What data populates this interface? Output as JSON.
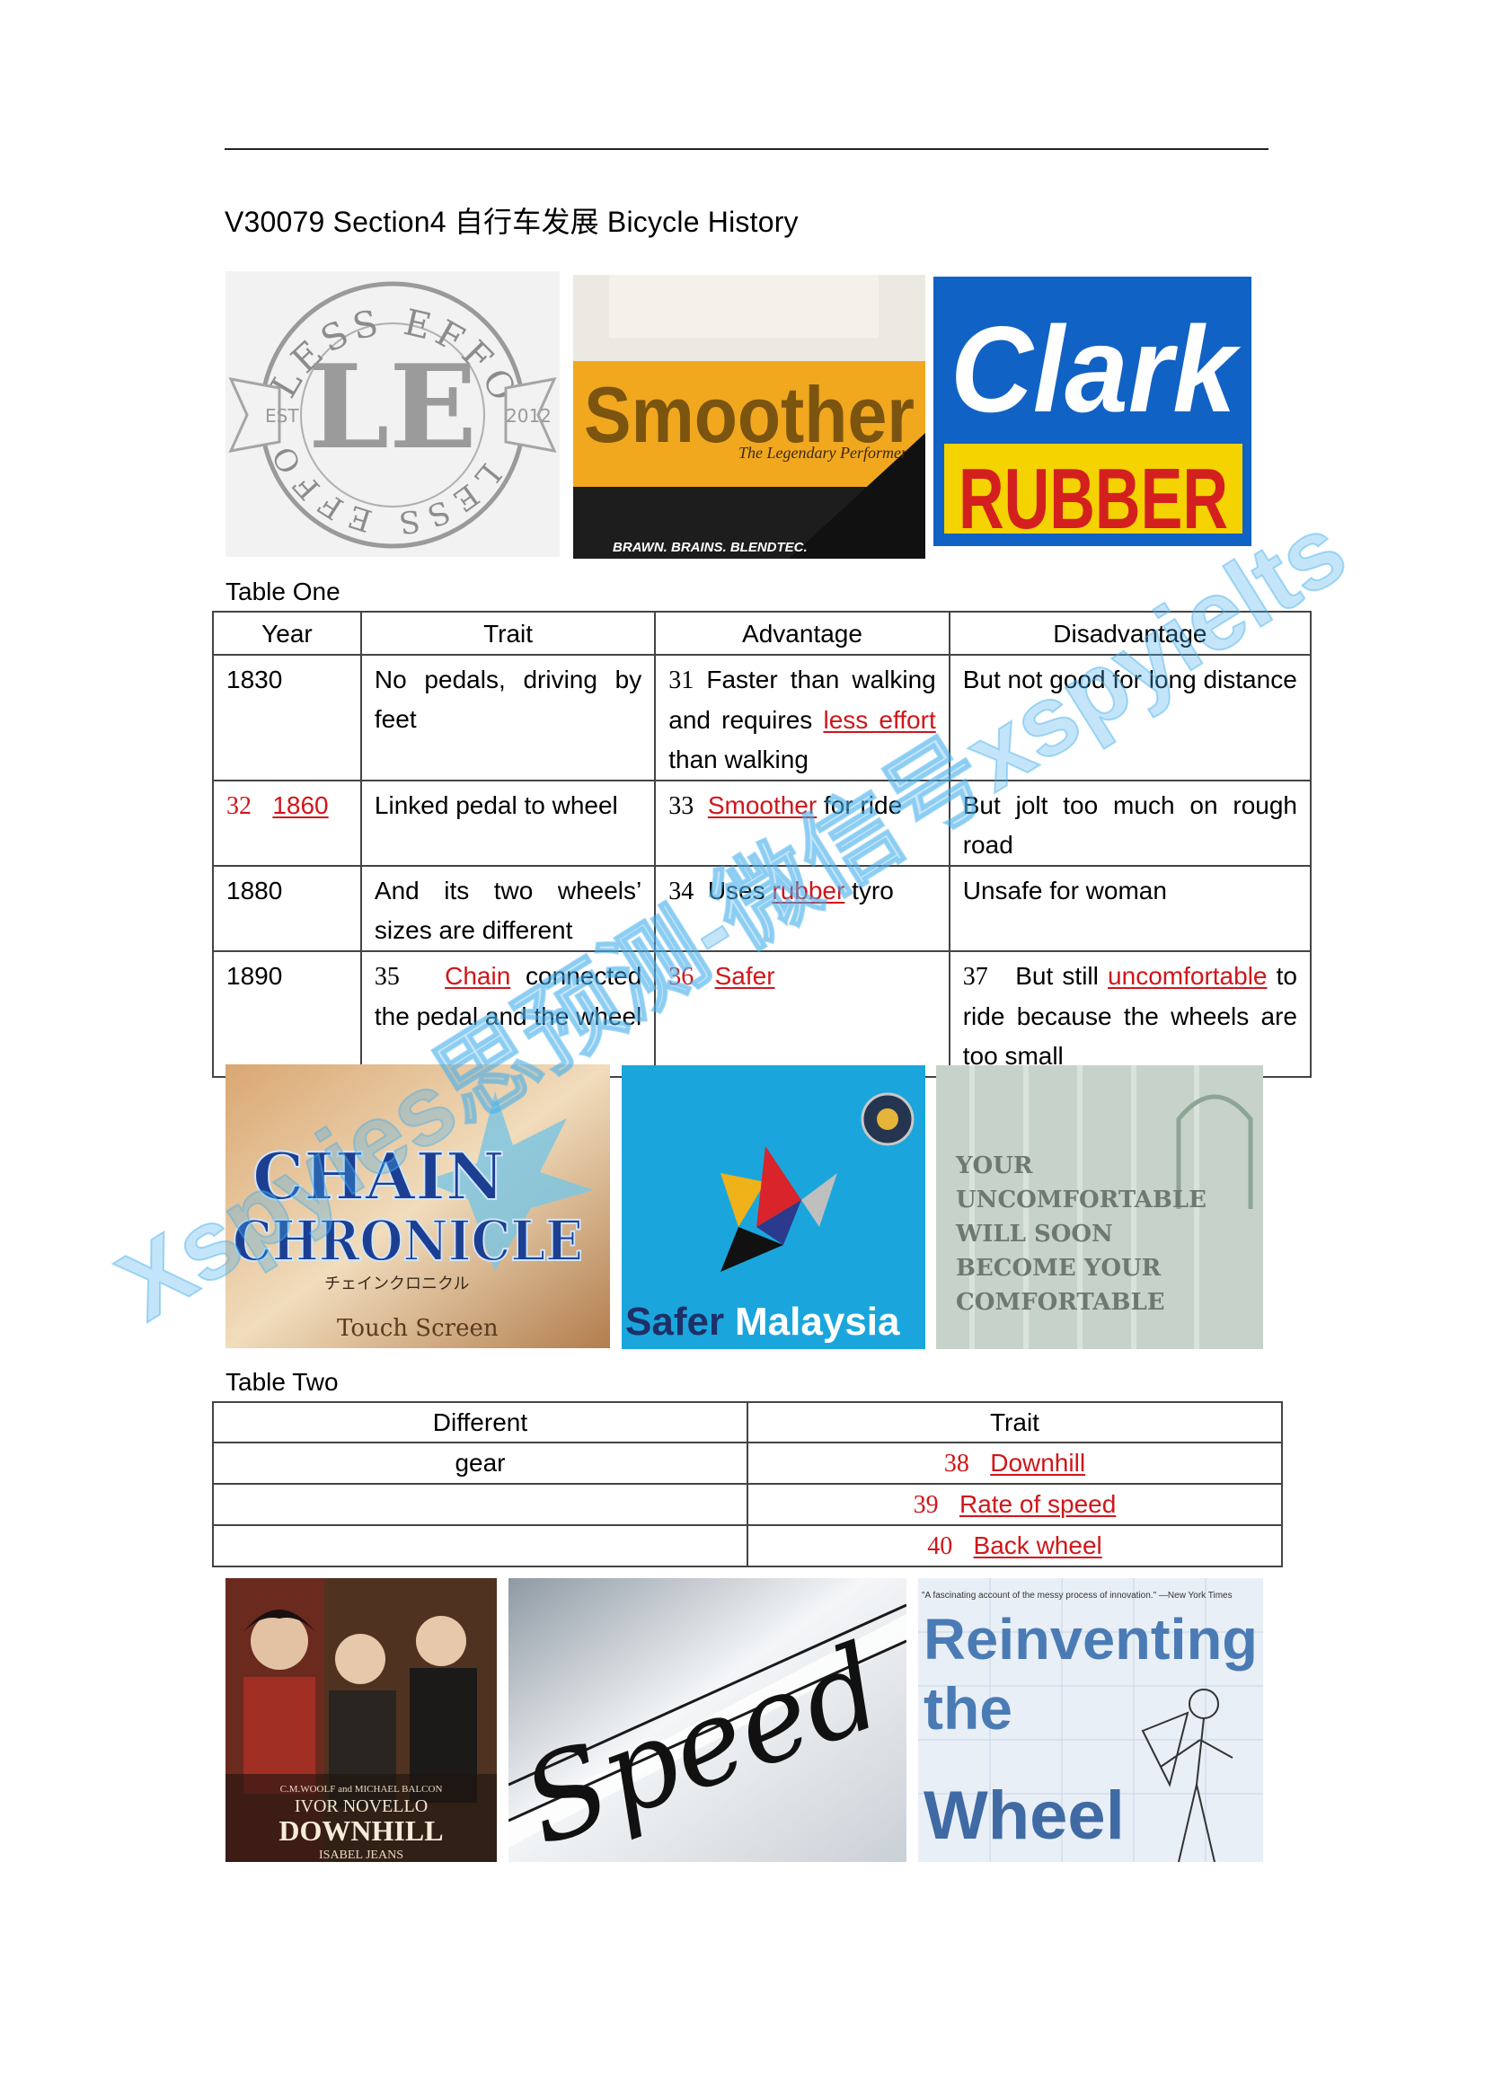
{
  "title": "V30079 Section4  自行车发展  Bicycle History",
  "images_top": [
    {
      "name": "less-effort-logo",
      "text_arc_top": "LESS EFFORT",
      "text_arc_bottom": "LESS EFFORT",
      "monogram": "LE",
      "est": "EST",
      "year": "2012"
    },
    {
      "name": "smoother-logo",
      "brand": "Smoother",
      "tagline": "The Legendary Performer",
      "footer": "BRAWN. BRAINS. BLENDTEC."
    },
    {
      "name": "clark-rubber-logo",
      "line1": "Clark",
      "line2": "RUBBER"
    }
  ],
  "table_one": {
    "label": "Table One",
    "headers": [
      "Year",
      "Trait",
      "Advantage",
      "Disadvantage"
    ],
    "rows": [
      {
        "year": {
          "plain": "1830"
        },
        "trait": "No pedals, driving by feet",
        "advantage": {
          "num": "31",
          "pre": "Faster than walking and requires",
          "answer": "less effort",
          "post": "than walking"
        },
        "disadvantage": {
          "pre": "But not good for long distance"
        }
      },
      {
        "year": {
          "num": "32",
          "answer": "1860"
        },
        "trait": "Linked pedal to wheel",
        "advantage": {
          "num": "33",
          "answer": "Smoother",
          "post": "for ride"
        },
        "disadvantage": {
          "pre": "But jolt too much on rough road"
        }
      },
      {
        "year": {
          "plain": "1880"
        },
        "trait": "And its two wheels’ sizes are different",
        "advantage": {
          "num": "34",
          "pre": "Uses",
          "answer": "rubber",
          "post": "tyro"
        },
        "disadvantage": {
          "pre": "Unsafe for woman"
        }
      },
      {
        "year": {
          "plain": "1890"
        },
        "trait_num": "35",
        "trait_answer": "Chain",
        "trait": "connected the pedal and the wheel",
        "advantage": {
          "num": "36",
          "answer": "Safer"
        },
        "disadvantage": {
          "num": "37",
          "pre": "But still",
          "answer": "uncomfortable",
          "post": "to ride because the wheels are too small"
        }
      }
    ]
  },
  "images_middle": [
    {
      "name": "chain-chronicle-logo",
      "line1": "CHAIN",
      "line2": "CHRONICLE",
      "subtitle": "チェインクロニクル",
      "footer": "Touch Screen"
    },
    {
      "name": "safer-malaysia-logo",
      "word1": "Safer",
      "word2": "Malaysia"
    },
    {
      "name": "uncomfortable-sign",
      "text": [
        "YOUR",
        "UNCOMFORTABLE",
        "WILL SOON",
        "BECOME YOUR",
        "COMFORTABLE"
      ]
    }
  ],
  "table_two": {
    "label": "Table Two",
    "headers": [
      "Different",
      "Trait"
    ],
    "rows": [
      {
        "different": "gear",
        "num": "38",
        "answer": "Downhill"
      },
      {
        "different": "",
        "num": "39",
        "answer": "Rate of speed"
      },
      {
        "different": "",
        "num": "40",
        "answer": "Back wheel"
      }
    ]
  },
  "images_bottom": [
    {
      "name": "downhill-poster",
      "credit": "C.M.WOOLF and MICHAEL BALCON",
      "star": "IVOR NOVELLO",
      "title": "DOWNHILL",
      "costar": "ISABEL JEANS"
    },
    {
      "name": "speed-badge",
      "word": "Speed"
    },
    {
      "name": "reinventing-wheel-cover",
      "quote": "\"A fascinating account of the messy process of innovation.\" —New York Times",
      "line1": "Reinventing",
      "line2": "the",
      "line3": "Wheel"
    }
  ],
  "watermark": "Xspyies思预测-微信号xspyielts",
  "colors": {
    "answer_red": "#d0161a",
    "clark_blue": "#1162c5",
    "clark_yellow": "#f4d300",
    "safer_blue": "#1aa6dc",
    "reinvent_blue": "#4a7bb5"
  }
}
